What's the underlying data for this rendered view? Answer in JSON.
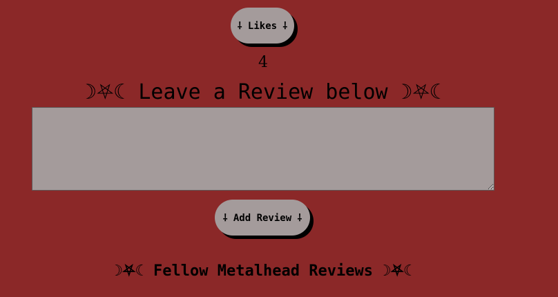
{
  "likes": {
    "button_label": "⸸ Likes ⸸",
    "count": "4"
  },
  "review": {
    "heading_decor_left": "☽⛧☾",
    "heading_text": " Leave a Review below ",
    "heading_decor_right": "☽⛧☾",
    "input_value": "",
    "input_placeholder": "",
    "add_button_label": "⸸ Add Review ⸸"
  },
  "reviews_list": {
    "heading_decor_left": "☽⛧☾",
    "heading_text": " Fellow Metalhead Reviews ",
    "heading_decor_right": "☽⛧☾"
  },
  "colors": {
    "background": "#8b2828",
    "button_bg": "#a49b9b",
    "button_shadow": "#000000",
    "text": "#000000"
  }
}
